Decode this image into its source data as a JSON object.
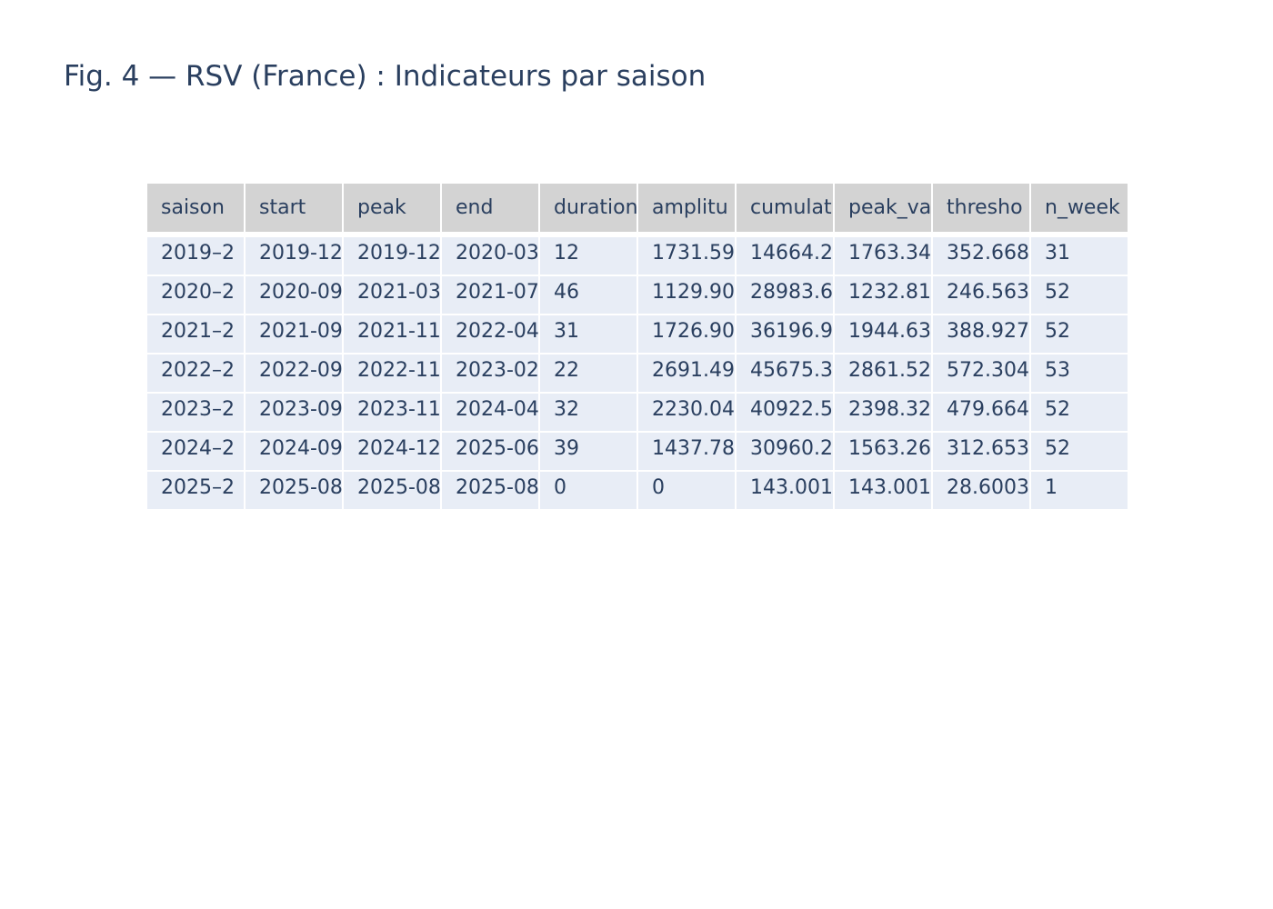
{
  "title": "Fig. 4 — RSV (France) : Indicateurs par saison",
  "chart_data": {
    "type": "table",
    "title": "Fig. 4 — RSV (France) : Indicateurs par saison",
    "columns": [
      "saison",
      "start",
      "peak",
      "end",
      "duration",
      "amplitude",
      "cumulative",
      "peak_value",
      "threshold",
      "n_weeks"
    ],
    "header_display": [
      "saison",
      "start",
      "peak",
      "end",
      "duration",
      "amplitu",
      "cumulat",
      "peak_va",
      "thresho",
      "n_week"
    ],
    "rows": [
      [
        "2019–2",
        "2019-12",
        "2019-12",
        "2020-03",
        "12",
        "1731.59",
        "14664.2",
        "1763.34",
        "352.668",
        "31"
      ],
      [
        "2020–2",
        "2020-09",
        "2021-03",
        "2021-07",
        "46",
        "1129.90",
        "28983.6",
        "1232.81",
        "246.563",
        "52"
      ],
      [
        "2021–2",
        "2021-09",
        "2021-11",
        "2022-04",
        "31",
        "1726.90",
        "36196.9",
        "1944.63",
        "388.927",
        "52"
      ],
      [
        "2022–2",
        "2022-09",
        "2022-11",
        "2023-02",
        "22",
        "2691.49",
        "45675.3",
        "2861.52",
        "572.304",
        "53"
      ],
      [
        "2023–2",
        "2023-09",
        "2023-11",
        "2024-04",
        "32",
        "2230.04",
        "40922.5",
        "2398.32",
        "479.664",
        "52"
      ],
      [
        "2024–2",
        "2024-09",
        "2024-12",
        "2025-06",
        "39",
        "1437.78",
        "30960.2",
        "1563.26",
        "312.653",
        "52"
      ],
      [
        "2025–2",
        "2025-08",
        "2025-08",
        "2025-08",
        "0",
        "0",
        "143.001",
        "143.001",
        "28.6003",
        "1"
      ]
    ],
    "colors": {
      "header_fill": "#d3d3d3",
      "cell_fill": "#e8edf6",
      "text": "#2a3f5f"
    }
  }
}
